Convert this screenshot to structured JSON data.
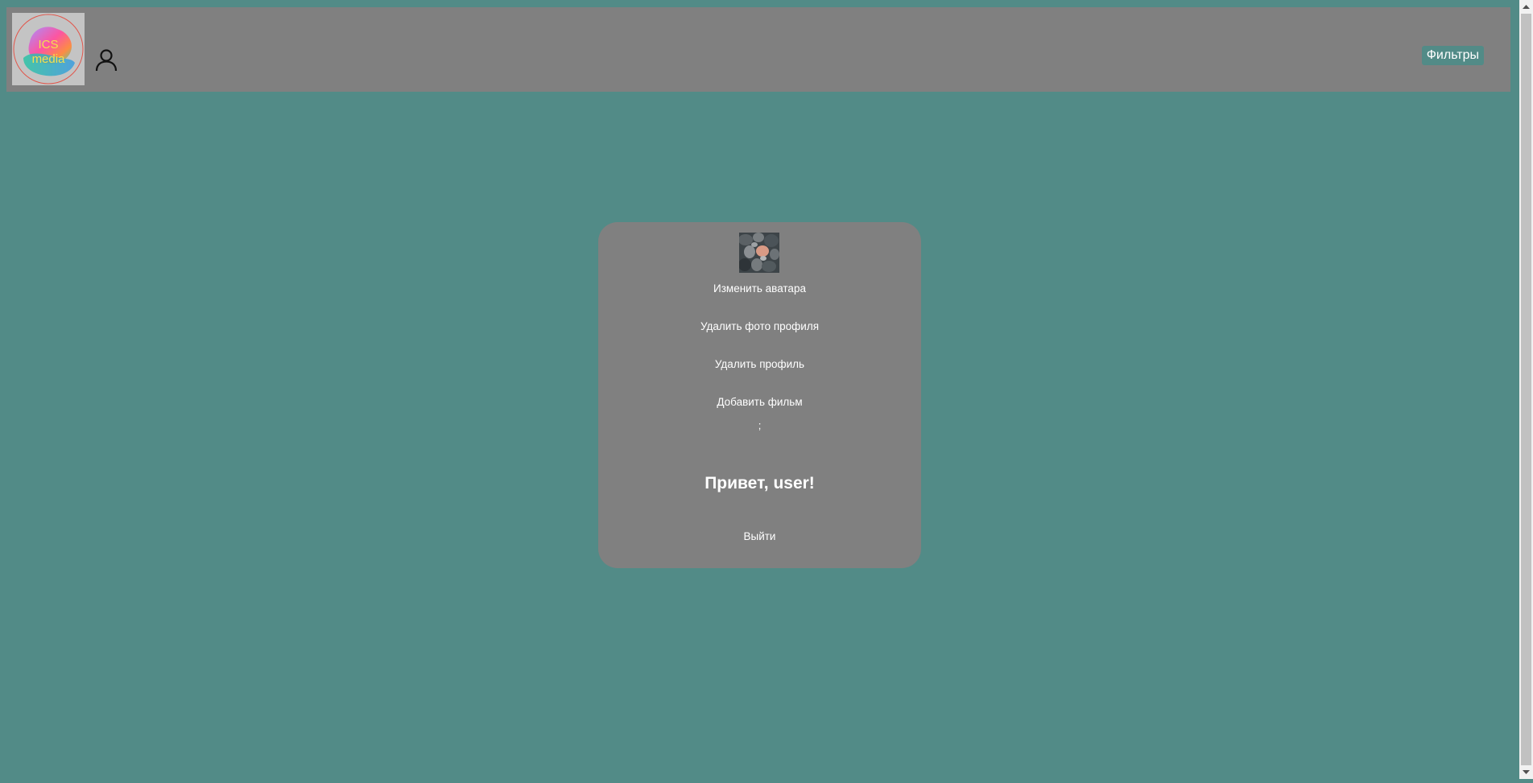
{
  "header": {
    "logo": {
      "text_line1": "ICS",
      "text_line2": "media"
    },
    "user_icon": "user-icon",
    "filters_label": "Фильтры"
  },
  "profile": {
    "avatar_alt": "avatar",
    "change_avatar": "Изменить аватара",
    "delete_photo": "Удалить фото профиля",
    "delete_profile": "Удалить профиль",
    "add_movie": "Добавить фильм",
    "separator": ";",
    "greeting": "Привет, user!",
    "logout": "Выйти"
  },
  "colors": {
    "page_bg": "#528b87",
    "header_bg": "#808080",
    "card_bg": "#808080",
    "text": "#ffffff"
  }
}
